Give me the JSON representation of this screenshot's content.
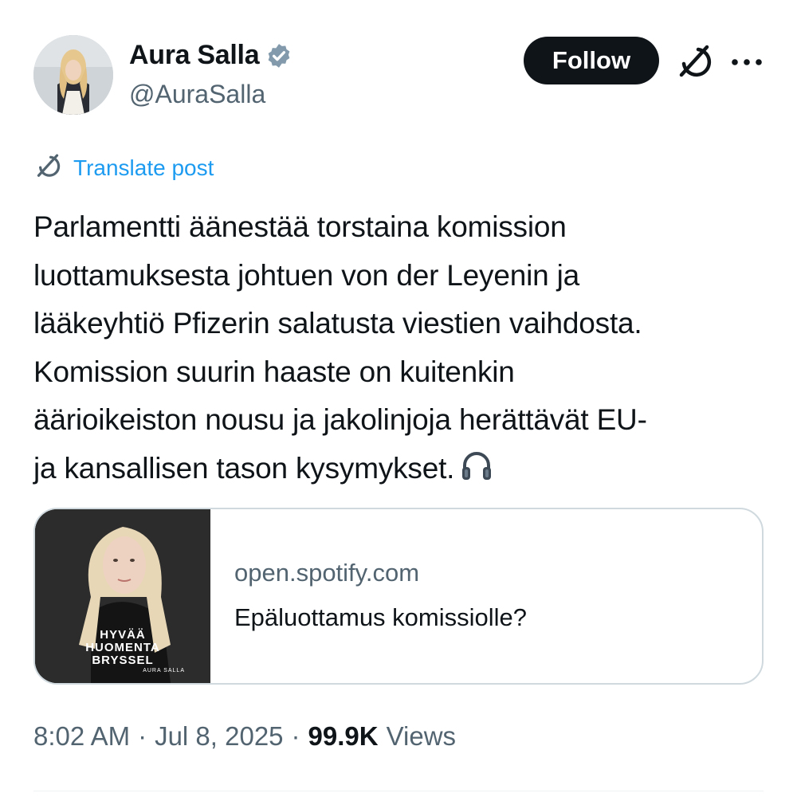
{
  "author": {
    "name": "Aura Salla",
    "handle": "@AuraSalla",
    "verified": true,
    "avatar_icon": "profile-photo"
  },
  "actions": {
    "follow_label": "Follow",
    "grok_icon": "grok-icon",
    "more_icon": "more-dots-icon"
  },
  "translate": {
    "label": "Translate post",
    "icon": "grok-icon"
  },
  "tweet": {
    "lines": [
      "Parlamentti äänestää torstaina komission",
      "luottamuksesta johtuen von der Leyenin ja",
      "lääkeyhtiö Pfizerin salatusta viestien vaihdosta.",
      "Komission suurin haaste on kuitenkin",
      "äärioikeiston nousu ja jakolinjoja herättävät EU-",
      "ja kansallisen tason kysymykset."
    ],
    "emoji": "headphones-icon"
  },
  "link_card": {
    "domain": "open.spotify.com",
    "title": "Epäluottamus komissiolle?",
    "thumbnail": {
      "title_lines": [
        "HYVÄÄ",
        "HUOMENTA",
        "BRYSSEL"
      ],
      "author": "AURA SALLA"
    }
  },
  "meta": {
    "time": "8:02 AM",
    "separator": "·",
    "date": "Jul 8, 2025",
    "views_count": "99.9K",
    "views_label": "Views"
  },
  "colors": {
    "text_primary": "#0f1419",
    "text_secondary": "#536471",
    "link_blue": "#1d9bf0",
    "border": "#cfd9de",
    "button_bg": "#0f1419"
  }
}
